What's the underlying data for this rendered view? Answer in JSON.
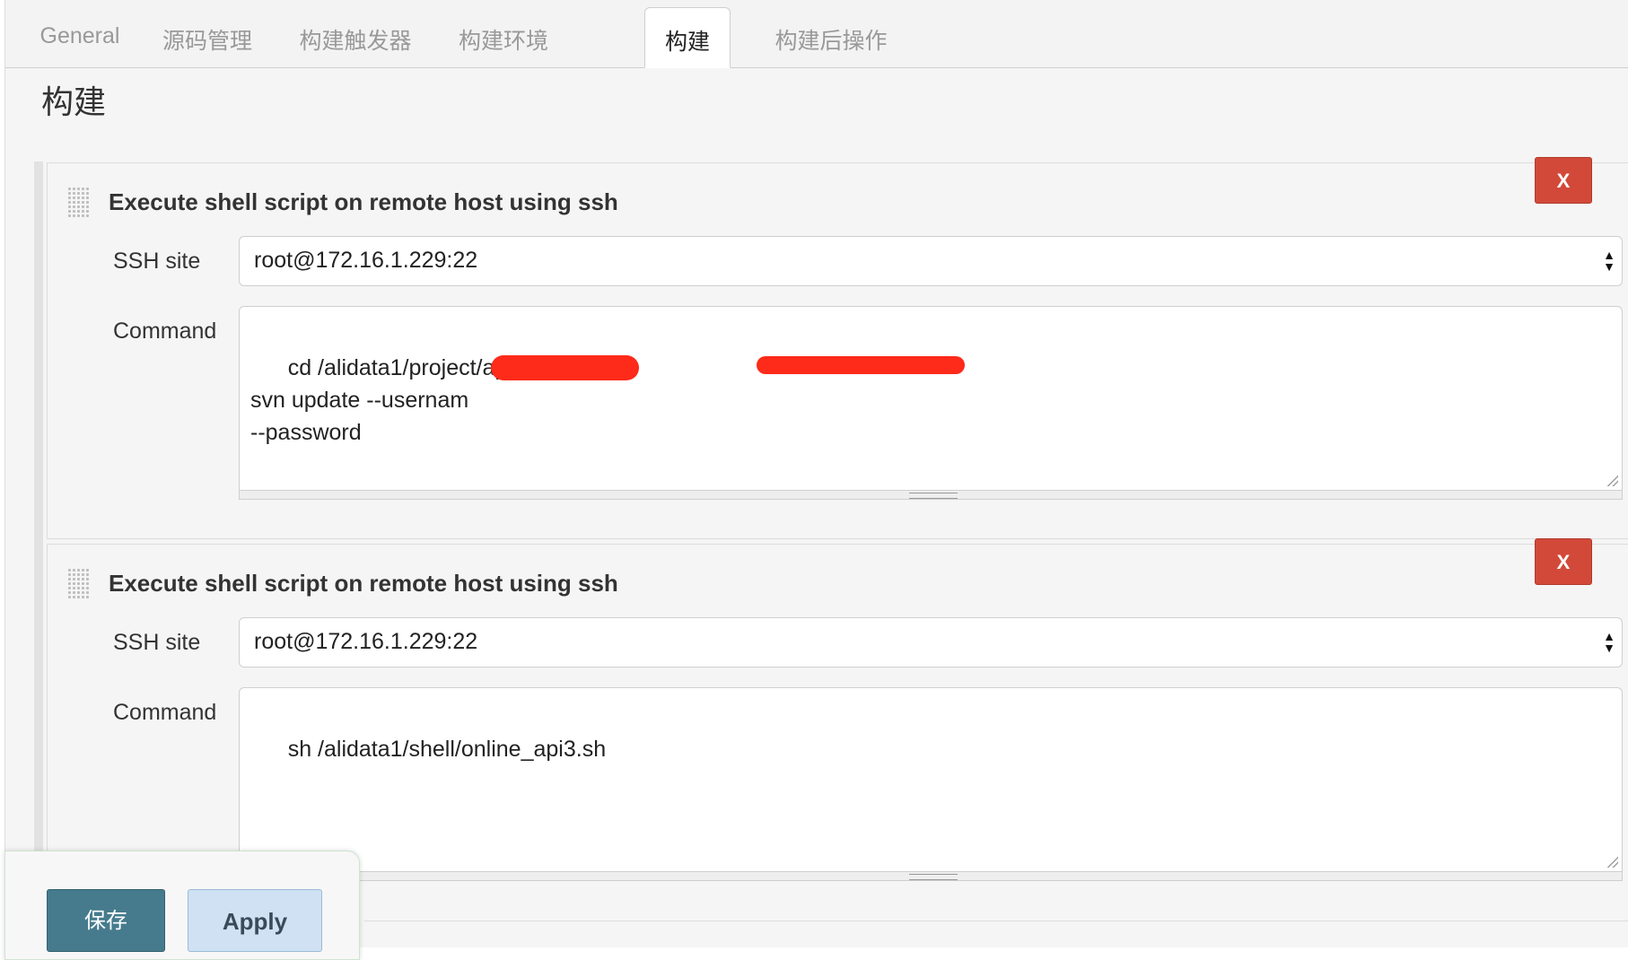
{
  "tabs": [
    {
      "label": "General"
    },
    {
      "label": "源码管理"
    },
    {
      "label": "构建触发器"
    },
    {
      "label": "构建环境"
    },
    {
      "label": "构建"
    },
    {
      "label": "构建后操作"
    }
  ],
  "active_tab": "构建",
  "section": {
    "title": "构建"
  },
  "steps": [
    {
      "title": "Execute shell script on remote host using ssh",
      "delete_label": "X",
      "ssh_site_label": "SSH site",
      "ssh_site_value": "root@172.16.1.229:22",
      "command_label": "Command",
      "command_value": "cd /alidata1/project/api3\nsvn update --usernam\n--password"
    },
    {
      "title": "Execute shell script on remote host using ssh",
      "delete_label": "X",
      "ssh_site_label": "SSH site",
      "ssh_site_value": "root@172.16.1.229:22",
      "command_label": "Command",
      "command_value": "sh /alidata1/shell/online_api3.sh"
    }
  ],
  "footer": {
    "save_label": "保存",
    "apply_label": "Apply"
  },
  "colors": {
    "delete": "#d24939",
    "save": "#467b8d",
    "apply": "#cfe1f2",
    "redaction": "#fe2a1a"
  }
}
